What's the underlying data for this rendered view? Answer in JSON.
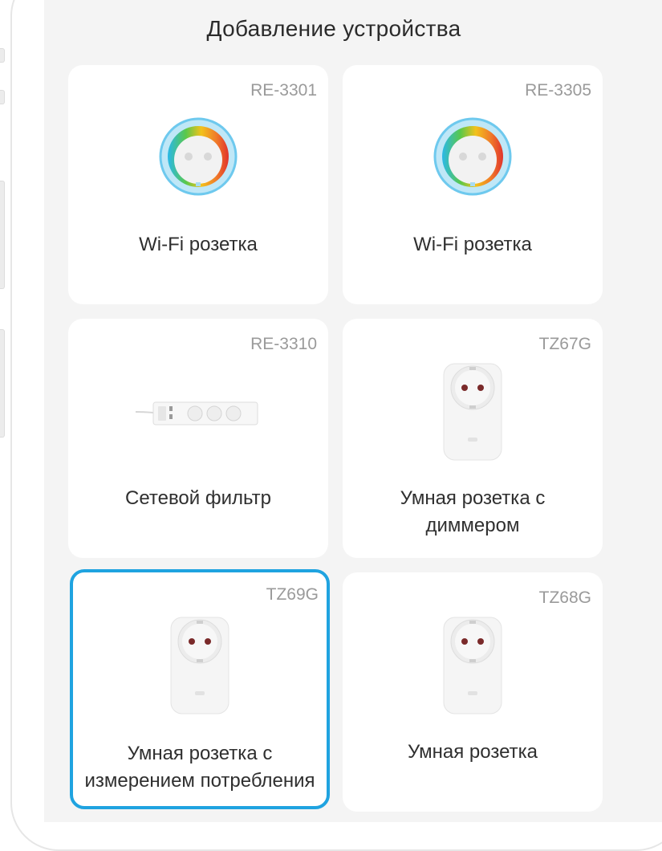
{
  "header": {
    "title": "Добавление устройства"
  },
  "devices": [
    {
      "model": "RE-3301",
      "name_line1": "Wi-Fi розетка",
      "name_line2": "",
      "image": "round-wifi-socket-icon",
      "selected": false
    },
    {
      "model": "RE-3305",
      "name_line1": "Wi-Fi розетка",
      "name_line2": "",
      "image": "round-wifi-socket-icon",
      "selected": false
    },
    {
      "model": "RE-3310",
      "name_line1": "Сетевой фильтр",
      "name_line2": "",
      "image": "power-strip-icon",
      "selected": false
    },
    {
      "model": "TZ67G",
      "name_line1": "Умная розетка с",
      "name_line2": "диммером",
      "image": "smart-plug-icon",
      "selected": false
    },
    {
      "model": "TZ69G",
      "name_line1": "Умная розетка с",
      "name_line2": "измерением потребления",
      "image": "smart-plug-icon",
      "selected": true
    },
    {
      "model": "TZ68G",
      "name_line1": "Умная розетка",
      "name_line2": "",
      "image": "smart-plug-icon",
      "selected": false
    }
  ],
  "colors": {
    "accent": "#1fa3e0",
    "background": "#f4f4f4",
    "card": "#ffffff",
    "model_text": "#9a9a9a"
  }
}
